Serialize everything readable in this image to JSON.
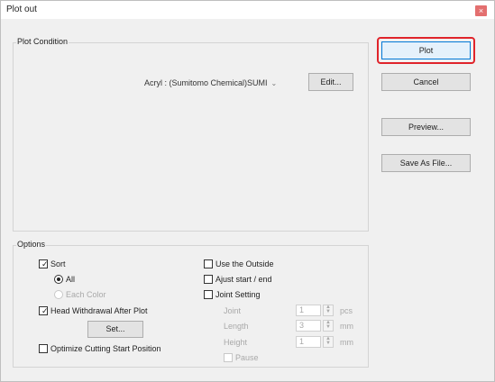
{
  "window": {
    "title": "Plot out",
    "close_symbol": "×"
  },
  "plot_condition": {
    "label": "Plot Condition",
    "material": "Acryl : (Sumitomo Chemical)SUMI",
    "edit_label": "Edit..."
  },
  "side_buttons": {
    "plot": "Plot",
    "cancel": "Cancel",
    "preview": "Preview...",
    "save_as_file": "Save As File..."
  },
  "options": {
    "label": "Options",
    "sort": {
      "label": "Sort",
      "checked": true
    },
    "all": {
      "label": "All",
      "selected": true
    },
    "each_color": {
      "label": "Each Color",
      "selected": false
    },
    "head_withdrawal": {
      "label": "Head Withdrawal After Plot",
      "checked": true
    },
    "set_label": "Set...",
    "optimize": {
      "label": "Optimize Cutting Start Position",
      "checked": false
    },
    "use_outside": {
      "label": "Use the Outside",
      "checked": false
    },
    "adjust_start_end": {
      "label": "Ajust start / end",
      "checked": false
    },
    "joint_setting": {
      "label": "Joint Setting",
      "checked": false
    },
    "joint": {
      "label": "Joint",
      "value": "1",
      "unit": "pcs"
    },
    "length": {
      "label": "Length",
      "value": "3",
      "unit": "mm"
    },
    "height": {
      "label": "Height",
      "value": "1",
      "unit": "mm"
    },
    "pause": {
      "label": "Pause",
      "checked": false
    }
  },
  "colors": {
    "highlight": "#e0242b",
    "close_button": "#e36f6f"
  }
}
